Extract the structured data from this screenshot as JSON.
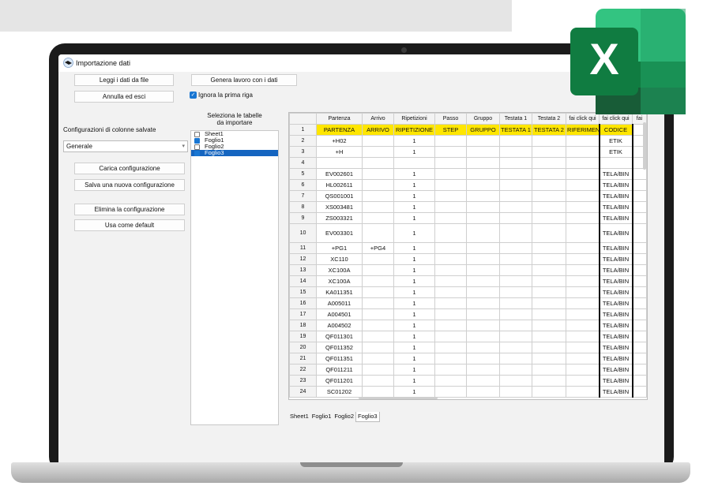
{
  "window": {
    "title": "Importazione dati"
  },
  "buttons": {
    "read_file": "Leggi i dati da file",
    "cancel_exit": "Annulla ed esci",
    "generate_job": "Genera lavoro con i dati",
    "load_config": "Carica configurazione",
    "save_config": "Salva una nuova configurazione",
    "delete_config": "Elimina la configurazione",
    "use_default": "Usa come default"
  },
  "options": {
    "ignore_first_row": "Ignora la prima riga",
    "ignore_first_row_checked": true
  },
  "config": {
    "label": "Configurazioni di colonne salvate",
    "selected": "Generale"
  },
  "sheets_panel": {
    "title_line1": "Seleziona le tabelle",
    "title_line2": "da importare",
    "items": [
      {
        "label": "Sheet1",
        "checked": false,
        "selected": false
      },
      {
        "label": "Foglio1",
        "checked": true,
        "selected": false
      },
      {
        "label": "Foglio2",
        "checked": false,
        "selected": false
      },
      {
        "label": "Foglio3",
        "checked": true,
        "selected": true
      }
    ]
  },
  "grid": {
    "headers": [
      "",
      "Partenza",
      "Arrivo",
      "Ripetizioni",
      "Passo",
      "Gruppo",
      "Testata 1",
      "Testata 2",
      "fai click qui",
      "fai click qui",
      "fai"
    ],
    "rows": [
      [
        "1",
        "PARTENZA",
        "ARRIVO",
        "RIPETIZIONE",
        "STEP",
        "GRUPPO",
        "TESTATA 1",
        "TESTATA 2",
        "RIFERIMENT",
        "CODICE",
        ""
      ],
      [
        "2",
        "+H02",
        "",
        "1",
        "",
        "",
        "",
        "",
        "",
        "ETIK",
        ""
      ],
      [
        "3",
        "+H",
        "",
        "1",
        "",
        "",
        "",
        "",
        "",
        "ETIK",
        ""
      ],
      [
        "4",
        "",
        "",
        "",
        "",
        "",
        "",
        "",
        "",
        "",
        ""
      ],
      [
        "5",
        "EV002601",
        "",
        "1",
        "",
        "",
        "",
        "",
        "",
        "TELA/BIN",
        ""
      ],
      [
        "6",
        "HL002611",
        "",
        "1",
        "",
        "",
        "",
        "",
        "",
        "TELA/BIN",
        ""
      ],
      [
        "7",
        "QS001001",
        "",
        "1",
        "",
        "",
        "",
        "",
        "",
        "TELA/BIN",
        ""
      ],
      [
        "8",
        "XS003481",
        "",
        "1",
        "",
        "",
        "",
        "",
        "",
        "TELA/BIN",
        ""
      ],
      [
        "9",
        "ZS003321",
        "",
        "1",
        "",
        "",
        "",
        "",
        "",
        "TELA/BIN",
        ""
      ],
      [
        "10",
        "EV003301",
        "",
        "1",
        "",
        "",
        "",
        "",
        "",
        "TELA/BIN",
        ""
      ],
      [
        "11",
        "+PG1",
        "+PG4",
        "1",
        "",
        "",
        "",
        "",
        "",
        "TELA/BIN",
        ""
      ],
      [
        "12",
        "XC110",
        "",
        "1",
        "",
        "",
        "",
        "",
        "",
        "TELA/BIN",
        ""
      ],
      [
        "13",
        "XC100A",
        "",
        "1",
        "",
        "",
        "",
        "",
        "",
        "TELA/BIN",
        ""
      ],
      [
        "14",
        "XC100A",
        "",
        "1",
        "",
        "",
        "",
        "",
        "",
        "TELA/BIN",
        ""
      ],
      [
        "15",
        "KA011351",
        "",
        "1",
        "",
        "",
        "",
        "",
        "",
        "TELA/BIN",
        ""
      ],
      [
        "16",
        "A005011",
        "",
        "1",
        "",
        "",
        "",
        "",
        "",
        "TELA/BIN",
        ""
      ],
      [
        "17",
        "A004501",
        "",
        "1",
        "",
        "",
        "",
        "",
        "",
        "TELA/BIN",
        ""
      ],
      [
        "18",
        "A004502",
        "",
        "1",
        "",
        "",
        "",
        "",
        "",
        "TELA/BIN",
        ""
      ],
      [
        "19",
        "QF011301",
        "",
        "1",
        "",
        "",
        "",
        "",
        "",
        "TELA/BIN",
        ""
      ],
      [
        "20",
        "QF011352",
        "",
        "1",
        "",
        "",
        "",
        "",
        "",
        "TELA/BIN",
        ""
      ],
      [
        "21",
        "QF011351",
        "",
        "1",
        "",
        "",
        "",
        "",
        "",
        "TELA/BIN",
        ""
      ],
      [
        "22",
        "QF011211",
        "",
        "1",
        "",
        "",
        "",
        "",
        "",
        "TELA/BIN",
        ""
      ],
      [
        "23",
        "QF011201",
        "",
        "1",
        "",
        "",
        "",
        "",
        "",
        "TELA/BIN",
        ""
      ],
      [
        "24",
        "SC01202",
        "",
        "1",
        "",
        "",
        "",
        "",
        "",
        "TELA/BIN",
        ""
      ]
    ]
  },
  "tabs": [
    "Sheet1",
    "Foglio1",
    "Foglio2",
    "Foglio3"
  ],
  "active_tab": 3,
  "logo": {
    "letter": "X",
    "name": "excel-logo"
  },
  "colors": {
    "highlight_row": "#ffe600",
    "selection": "#1565c0",
    "checkbox": "#1976d2",
    "excel_dark": "#185c37",
    "excel_mid": "#21a366",
    "excel_light": "#33c481",
    "excel_tile": "#107c41"
  }
}
